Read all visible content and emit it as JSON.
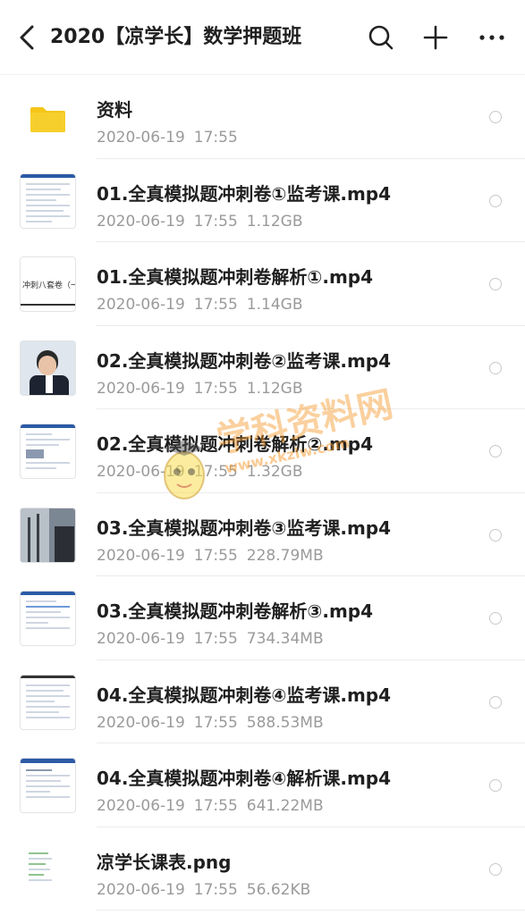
{
  "header": {
    "title": "2020【凉学长】数学押题班",
    "back_icon": "chevron-left-icon",
    "search_icon": "search-icon",
    "add_icon": "plus-icon",
    "more_icon": "more-icon"
  },
  "files": [
    {
      "name": "资料",
      "date": "2020-06-19",
      "time": "17:55",
      "size": "",
      "type": "folder"
    },
    {
      "name": "01.全真模拟题冲刺卷①监考课.mp4",
      "date": "2020-06-19",
      "time": "17:55",
      "size": "1.12GB",
      "type": "video"
    },
    {
      "name": "01.全真模拟题冲刺卷解析①.mp4",
      "date": "2020-06-19",
      "time": "17:55",
      "size": "1.14GB",
      "type": "video"
    },
    {
      "name": "02.全真模拟题冲刺卷②监考课.mp4",
      "date": "2020-06-19",
      "time": "17:55",
      "size": "1.12GB",
      "type": "video"
    },
    {
      "name": "02.全真模拟题冲刺卷解析②.mp4",
      "date": "2020-06-19",
      "time": "17:55",
      "size": "1.32GB",
      "type": "video"
    },
    {
      "name": "03.全真模拟题冲刺卷③监考课.mp4",
      "date": "2020-06-19",
      "time": "17:55",
      "size": "228.79MB",
      "type": "video"
    },
    {
      "name": "03.全真模拟题冲刺卷解析③.mp4",
      "date": "2020-06-19",
      "time": "17:55",
      "size": "734.34MB",
      "type": "video"
    },
    {
      "name": "04.全真模拟题冲刺卷④监考课.mp4",
      "date": "2020-06-19",
      "time": "17:55",
      "size": "588.53MB",
      "type": "video"
    },
    {
      "name": "04.全真模拟题冲刺卷④解析课.mp4",
      "date": "2020-06-19",
      "time": "17:55",
      "size": "641.22MB",
      "type": "video"
    },
    {
      "name": "凉学长课表.png",
      "date": "2020-06-19",
      "time": "17:55",
      "size": "56.62KB",
      "type": "image"
    }
  ],
  "thumb_text": {
    "slide": "冲刺八套卷（一）讲"
  },
  "watermark": {
    "text": "学科资料网",
    "url": "www.xkzlw.com"
  },
  "colors": {
    "folder": "#f5c518",
    "title": "#1f1f1f",
    "meta": "#9a9a9a",
    "accent": "#2b5aa6"
  }
}
